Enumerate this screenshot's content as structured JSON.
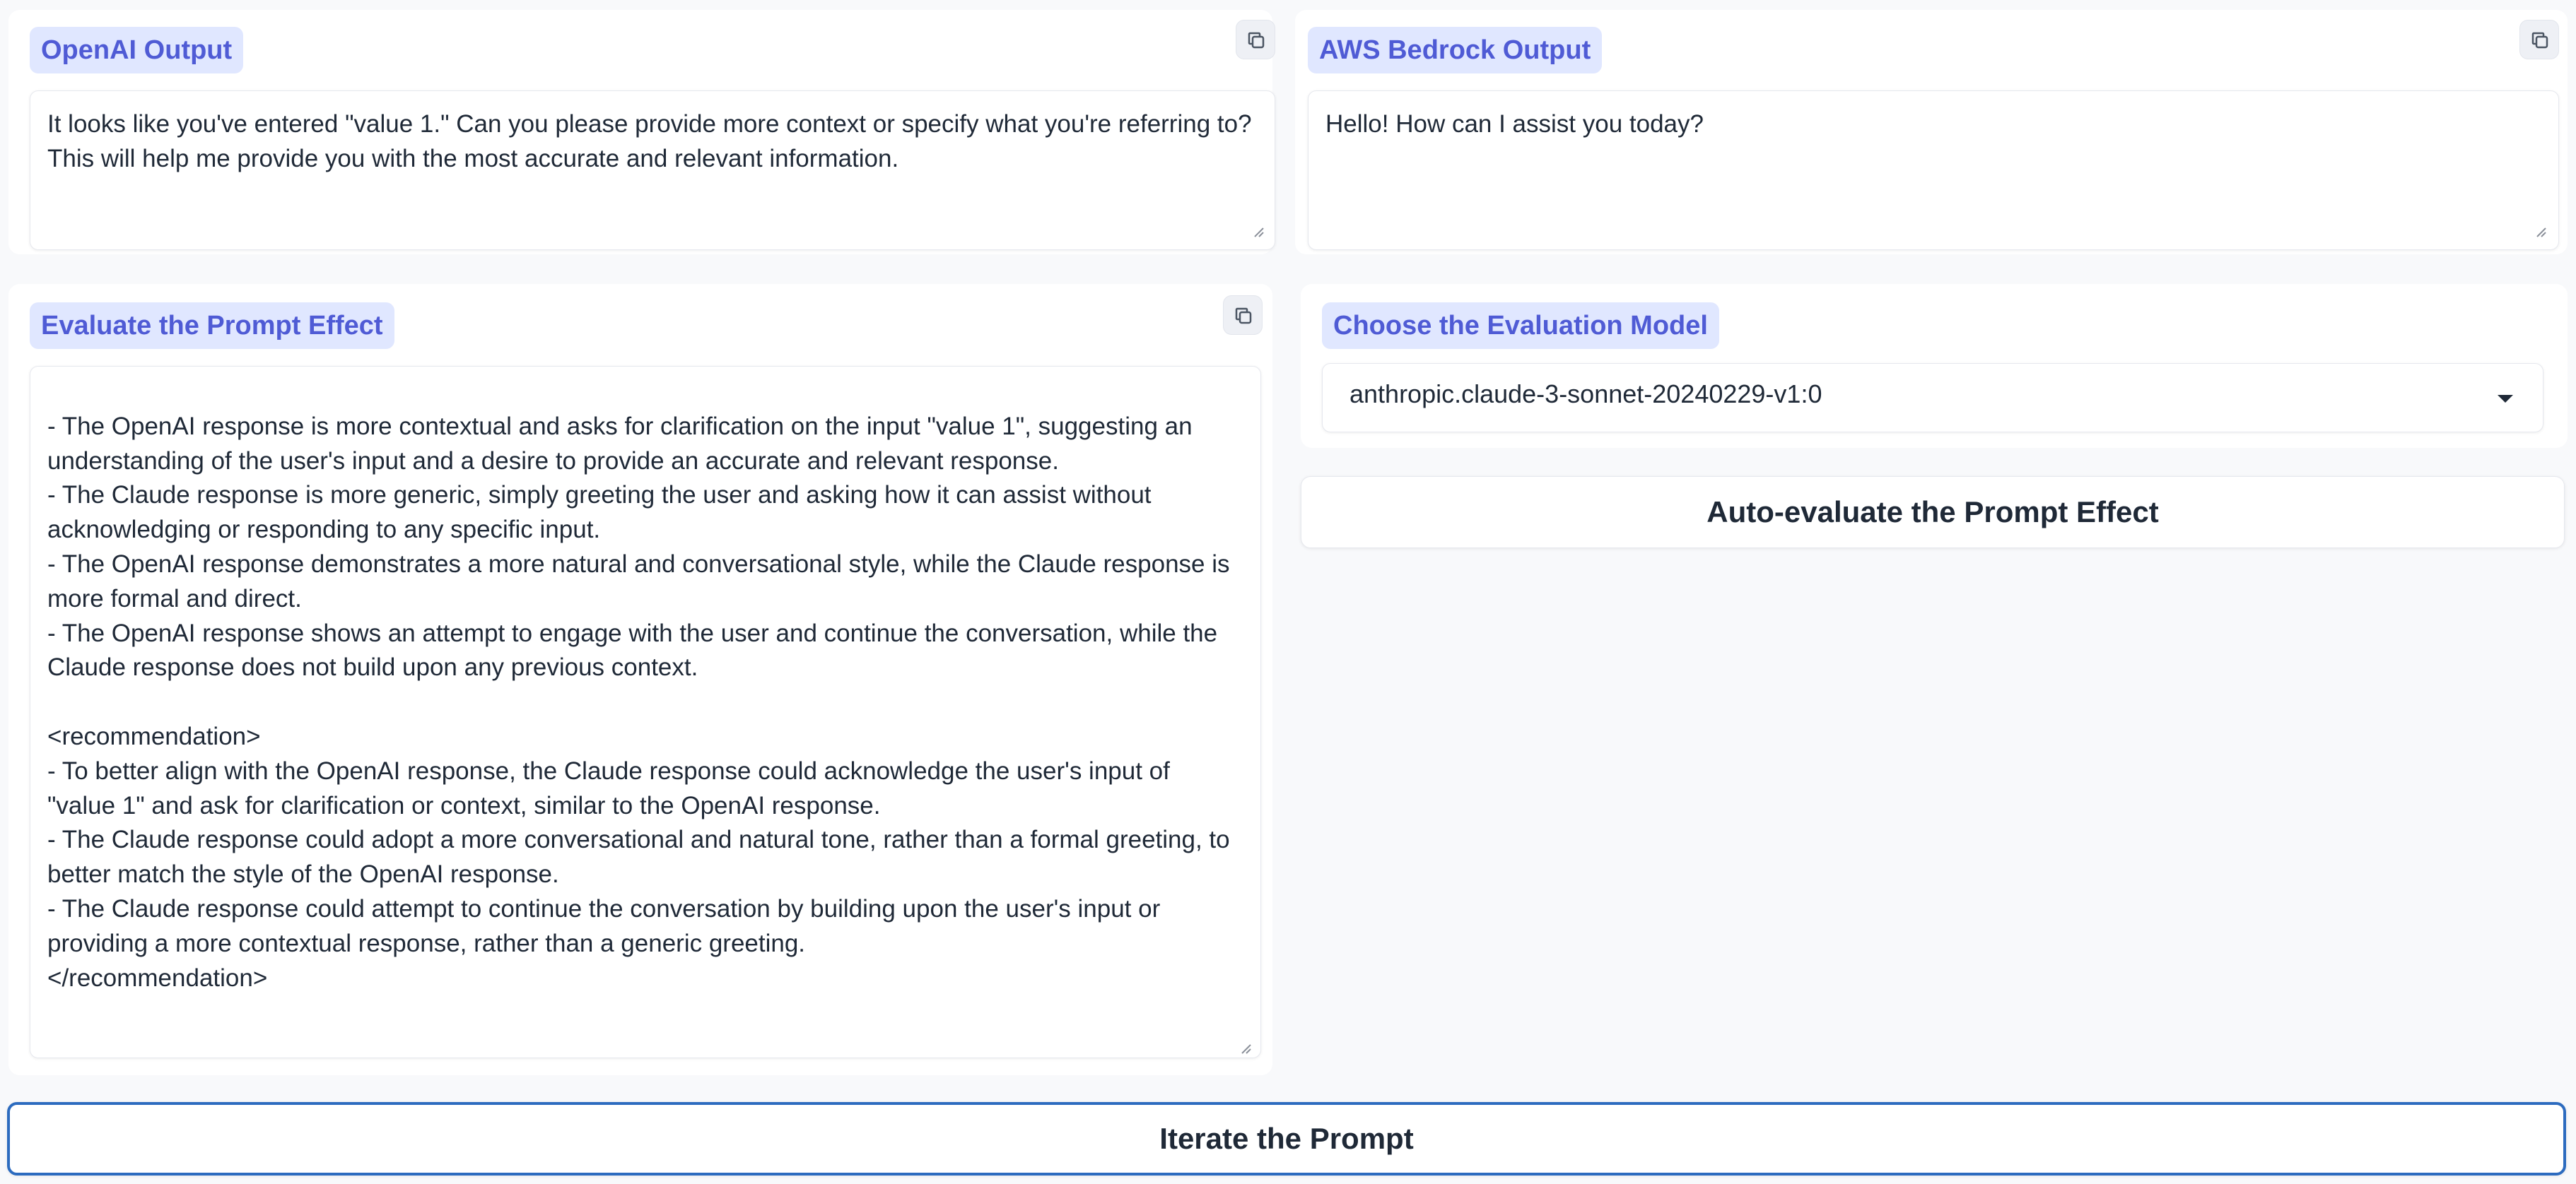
{
  "openai": {
    "label": "OpenAI Output",
    "text": "It looks like you've entered \"value 1.\" Can you please provide more context or specify what you're referring to? This will help me provide you with the most accurate and relevant information."
  },
  "bedrock": {
    "label": "AWS Bedrock Output",
    "text": "Hello! How can I assist you today?"
  },
  "evaluate": {
    "label": "Evaluate the Prompt Effect",
    "text": "\n- The OpenAI response is more contextual and asks for clarification on the input \"value 1\", suggesting an understanding of the user's input and a desire to provide an accurate and relevant response.\n- The Claude response is more generic, simply greeting the user and asking how it can assist without acknowledging or responding to any specific input.\n- The OpenAI response demonstrates a more natural and conversational style, while the Claude response is more formal and direct.\n- The OpenAI response shows an attempt to engage with the user and continue the conversation, while the Claude response does not build upon any previous context.\n\n<recommendation>\n- To better align with the OpenAI response, the Claude response could acknowledge the user's input of \"value 1\" and ask for clarification or context, similar to the OpenAI response.\n- The Claude response could adopt a more conversational and natural tone, rather than a formal greeting, to better match the style of the OpenAI response.\n- The Claude response could attempt to continue the conversation by building upon the user's input or providing a more contextual response, rather than a generic greeting.\n</recommendation>"
  },
  "model_select": {
    "label": "Choose the Evaluation Model",
    "value": "anthropic.claude-3-sonnet-20240229-v1:0"
  },
  "buttons": {
    "auto_evaluate": "Auto-evaluate the Prompt Effect",
    "iterate": "Iterate the Prompt"
  },
  "icons": {
    "copy": "copy-icon",
    "caret": "chevron-down-icon",
    "resize": "resize-handle-icon"
  },
  "colors": {
    "chip_bg": "#e0e7ff",
    "chip_text": "#4f5bd5",
    "primary_border": "#2c6bbf"
  }
}
